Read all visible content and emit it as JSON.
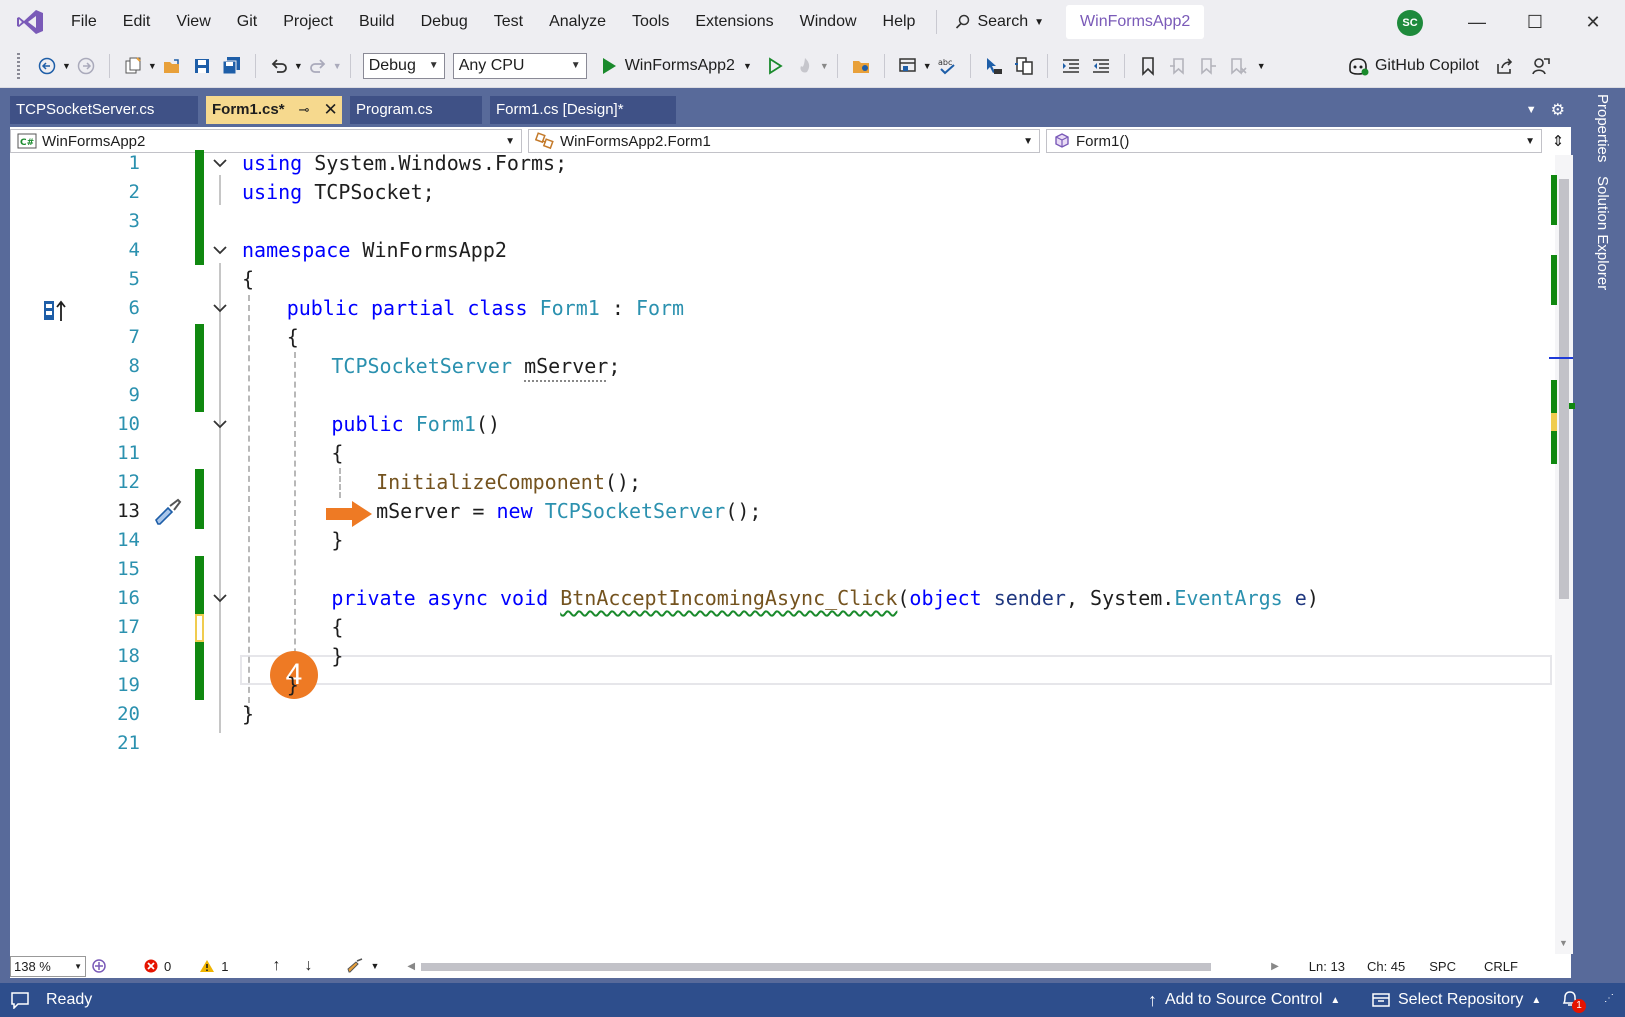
{
  "menu": [
    "File",
    "Edit",
    "View",
    "Git",
    "Project",
    "Build",
    "Debug",
    "Test",
    "Analyze",
    "Tools",
    "Extensions",
    "Window",
    "Help"
  ],
  "search_label": "Search",
  "solution_name": "WinFormsApp2",
  "avatar_initials": "SC",
  "toolbar": {
    "config": "Debug",
    "platform": "Any CPU",
    "run_target": "WinFormsApp2",
    "copilot": "GitHub Copilot"
  },
  "tabs": [
    {
      "label": "TCPSocketServer.cs"
    },
    {
      "label": "Form1.cs*"
    },
    {
      "label": "Program.cs"
    },
    {
      "label": "Form1.cs [Design]*"
    }
  ],
  "nav": {
    "project": "WinFormsApp2",
    "type": "WinFormsApp2.Form1",
    "member": "Form1()"
  },
  "code_lines": [
    {
      "n": "1",
      "code": "using System.Windows.Forms;"
    },
    {
      "n": "2",
      "code": "using TCPSocket;"
    },
    {
      "n": "3",
      "code": ""
    },
    {
      "n": "4",
      "code": "namespace WinFormsApp2"
    },
    {
      "n": "5",
      "code": "{"
    },
    {
      "n": "6",
      "code": "public partial class Form1 : Form"
    },
    {
      "n": "7",
      "code": "{"
    },
    {
      "n": "8",
      "code": "TCPSocketServer mServer;"
    },
    {
      "n": "9",
      "code": ""
    },
    {
      "n": "10",
      "code": "public Form1()"
    },
    {
      "n": "11",
      "code": "{"
    },
    {
      "n": "12",
      "code": "InitializeComponent();"
    },
    {
      "n": "13",
      "code": "mServer = new TCPSocketServer();"
    },
    {
      "n": "14",
      "code": "}"
    },
    {
      "n": "15",
      "code": ""
    },
    {
      "n": "16",
      "code": "private async void BtnAcceptIncomingAsync_Click(object sender, System.EventArgs e)"
    },
    {
      "n": "17",
      "code": "{"
    },
    {
      "n": "18",
      "code": "}"
    },
    {
      "n": "19",
      "code": "}"
    },
    {
      "n": "20",
      "code": "}"
    },
    {
      "n": "21",
      "code": ""
    }
  ],
  "callout_number": "4",
  "side_tabs": [
    "Properties",
    "Solution Explorer"
  ],
  "bottom": {
    "zoom": "138 %",
    "errors": "0",
    "warnings": "1",
    "ln": "Ln: 13",
    "ch": "Ch: 45",
    "spc": "SPC",
    "crlf": "CRLF"
  },
  "status": {
    "ready": "Ready",
    "source_control": "Add to Source Control",
    "repository": "Select Repository",
    "notifications": "1"
  },
  "colors": {
    "accent": "#7a5ab8",
    "status_bar": "#2e4e8c",
    "callout": "#ee7a24",
    "change_bar": "#108810"
  }
}
